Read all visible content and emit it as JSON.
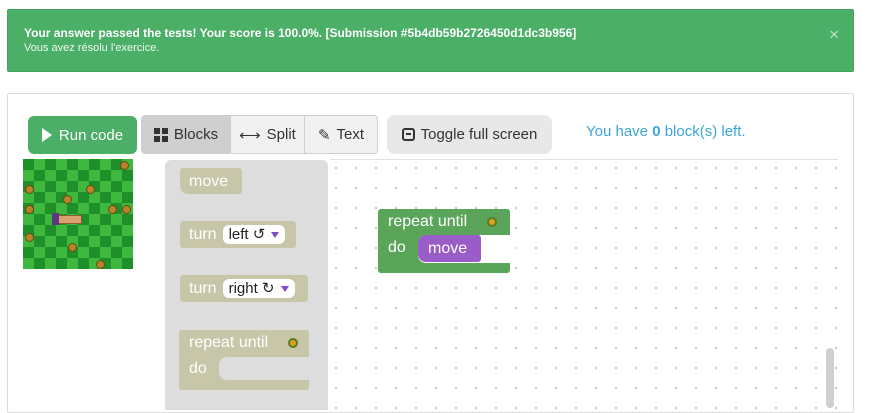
{
  "banner": {
    "message": "Your answer passed the tests! Your score is 100.0%. [Submission #5b4db59b2726450d1dc3b956]",
    "submessage": "Vous avez résolu l'exercice.",
    "close": "×",
    "color": "#4caf68"
  },
  "toolbar": {
    "run_label": "Run code",
    "blocks_label": "Blocks",
    "split_label": "Split",
    "text_label": "Text",
    "fullscreen_label": "Toggle full screen",
    "blocks_left_prefix": "You have ",
    "blocks_left_count": "0",
    "blocks_left_suffix": " block(s) left."
  },
  "toolbox": {
    "move_label": "move",
    "turn_left_label": "turn",
    "turn_left_option": "left ↺",
    "turn_right_label": "turn",
    "turn_right_option": "right ↻",
    "repeat_label": "repeat until",
    "do_label": "do"
  },
  "workspace": {
    "repeat_label": "repeat until",
    "do_label": "do",
    "move_label": "move"
  },
  "icons": {
    "run": "play-icon",
    "blocks": "grid-icon",
    "split": "double-arrow-icon",
    "text": "pencil-icon",
    "fullscreen": "fullscreen-icon",
    "goal": "flower-icon"
  },
  "colors": {
    "accent_green": "#4caf68",
    "info_blue": "#3fa5d6",
    "loop_block": "#5ba55b",
    "move_block": "#9a5cc6",
    "ghost_block": "#c8c6a8"
  }
}
